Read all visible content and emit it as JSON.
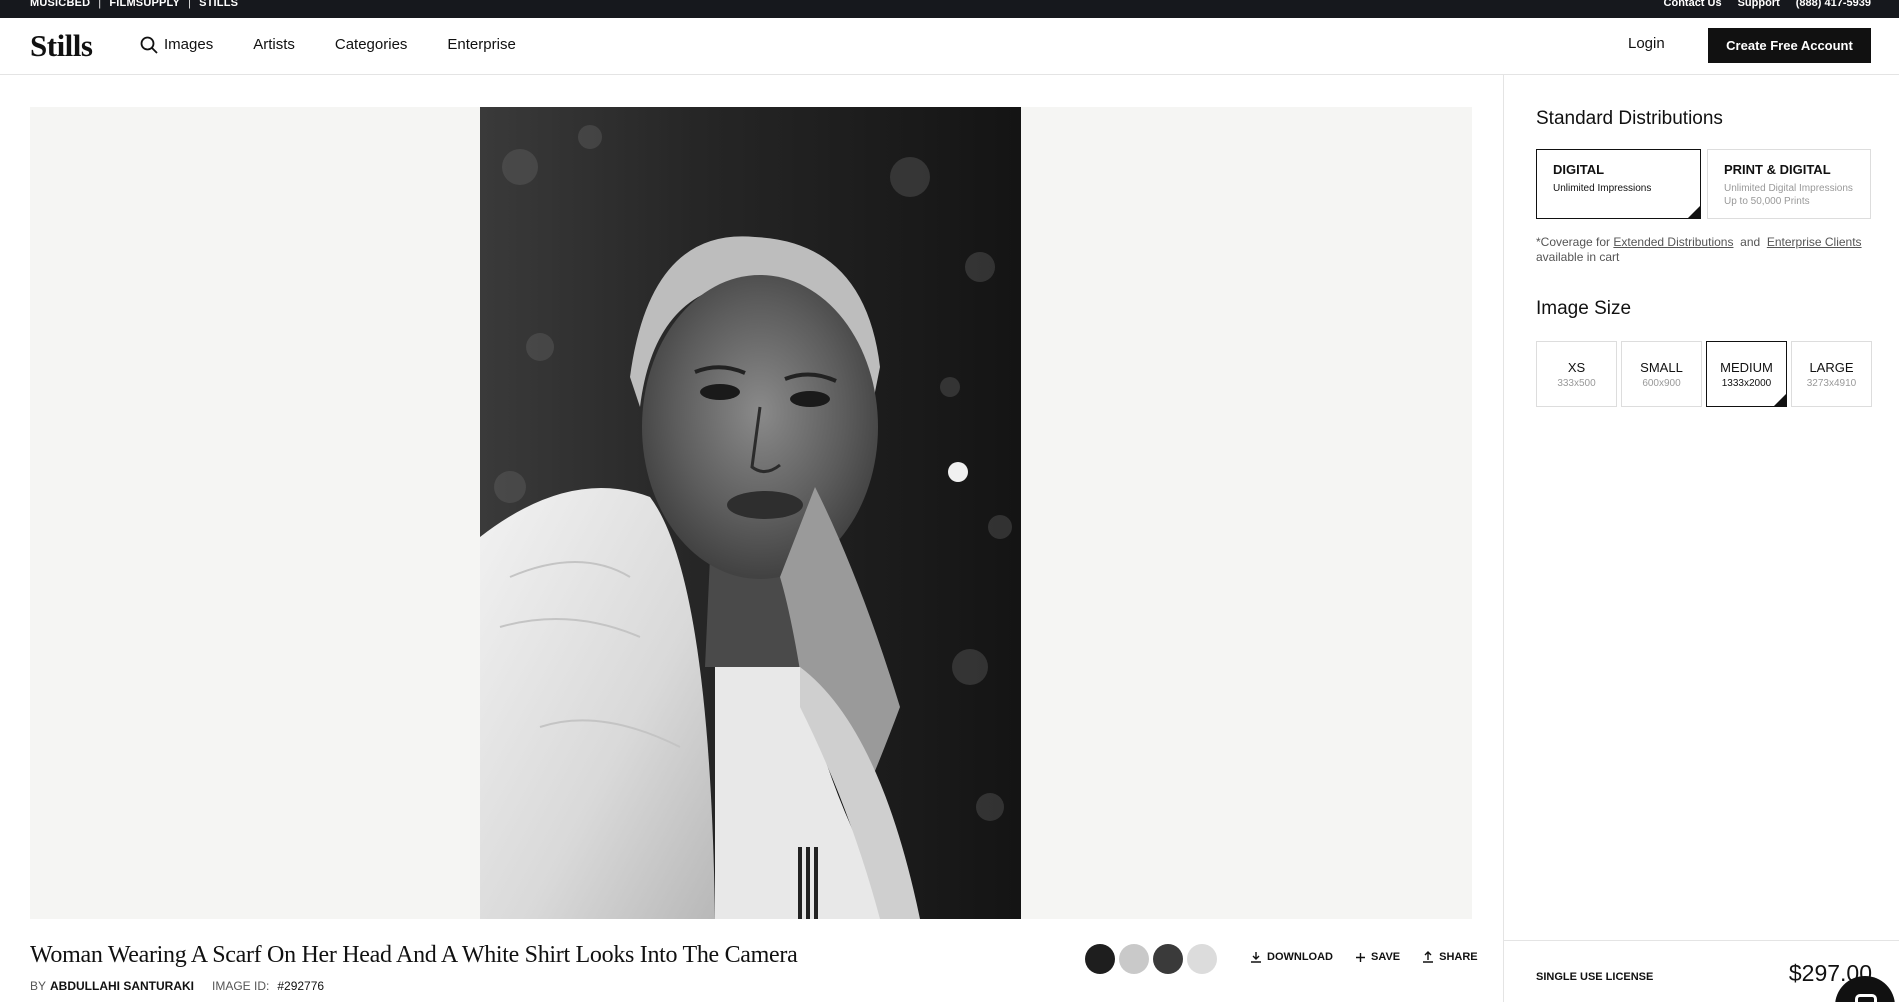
{
  "topbar": {
    "brands": [
      "MUSICBED",
      "FILMSUPPLY",
      "STILLS"
    ],
    "separator": "|",
    "links": [
      "Contact Us",
      "Support",
      "(888) 417-5939"
    ]
  },
  "header": {
    "logo": "Stills",
    "nav": [
      "Images",
      "Artists",
      "Categories",
      "Enterprise"
    ],
    "login": "Login",
    "cta": "Create Free Account"
  },
  "photo": {
    "icon": "portrait-photo"
  },
  "details": {
    "title": "Woman Wearing A Scarf On Her Head And A White Shirt Looks Into The Camera",
    "by_label": "BY",
    "artist": "ABDULLAHI SANTURAKI",
    "image_id_label": "IMAGE ID:",
    "image_id": "#292776",
    "swatch_colors": [
      "#1e1e1e",
      "#c9c9c9",
      "#3a3a3a",
      "#dcdcdc"
    ],
    "actions": [
      "DOWNLOAD",
      "SAVE",
      "SHARE"
    ]
  },
  "panel": {
    "distributions_heading": "Standard Distributions",
    "distributions": [
      {
        "title": "DIGITAL",
        "lines": [
          "Unlimited Impressions"
        ],
        "selected": true
      },
      {
        "title": "PRINT & DIGITAL",
        "lines": [
          "Unlimited Digital Impressions",
          "Up to 50,000 Prints"
        ],
        "selected": false
      }
    ],
    "coverage": {
      "prefix": "*Coverage for",
      "link1": "Extended Distributions",
      "and": "and",
      "link2": "Enterprise Clients",
      "suffix": "available in cart"
    },
    "size_heading": "Image Size",
    "sizes": [
      {
        "name": "XS",
        "dims": "333x500",
        "selected": false
      },
      {
        "name": "SMALL",
        "dims": "600x900",
        "selected": false
      },
      {
        "name": "MEDIUM",
        "dims": "1333x2000",
        "selected": true
      },
      {
        "name": "LARGE",
        "dims": "3273x4910",
        "selected": false
      }
    ],
    "license": "SINGLE USE LICENSE",
    "price": "$297.00"
  }
}
